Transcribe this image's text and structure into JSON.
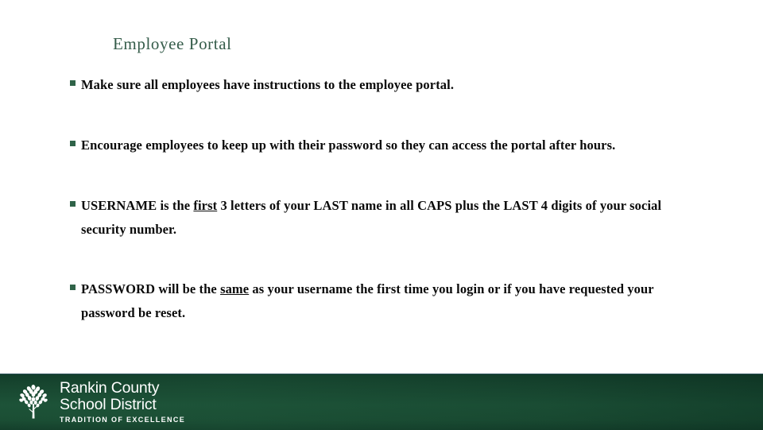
{
  "slide": {
    "title": "Employee Portal",
    "title_color": "#355c4a",
    "background_color": "#ffffff",
    "bullet_marker_color": "#2f6348",
    "body_text_color": "#0a0a0a",
    "bullets": [
      {
        "id": "bullet-instructions",
        "segments": [
          {
            "text": "Make sure all employees have instructions to the employee portal.",
            "underline": false
          }
        ]
      },
      {
        "id": "bullet-password-upkeep",
        "segments": [
          {
            "text": "Encourage employees to keep up with their password so they can access the portal after hours.",
            "underline": false
          }
        ]
      },
      {
        "id": "bullet-username-rule",
        "segments": [
          {
            "text": "USERNAME is the ",
            "underline": false
          },
          {
            "text": "first",
            "underline": true
          },
          {
            "text": " 3 letters of your LAST name in all CAPS plus the LAST 4 digits of your social security number.",
            "underline": false
          }
        ]
      },
      {
        "id": "bullet-password-rule",
        "segments": [
          {
            "text": "PASSWORD will be the ",
            "underline": false
          },
          {
            "text": "same",
            "underline": true
          },
          {
            "text": " as your username the first time you login or if you have requested your password be reset.",
            "underline": false
          }
        ]
      }
    ]
  },
  "footer": {
    "band_color_top": "#123d2a",
    "band_color_mid": "#1d5338",
    "logo": {
      "icon": "tree-icon",
      "line1": "Rankin County",
      "line2": "School District",
      "tagline": "TRADITION OF EXCELLENCE",
      "text_color": "#ffffff"
    }
  }
}
